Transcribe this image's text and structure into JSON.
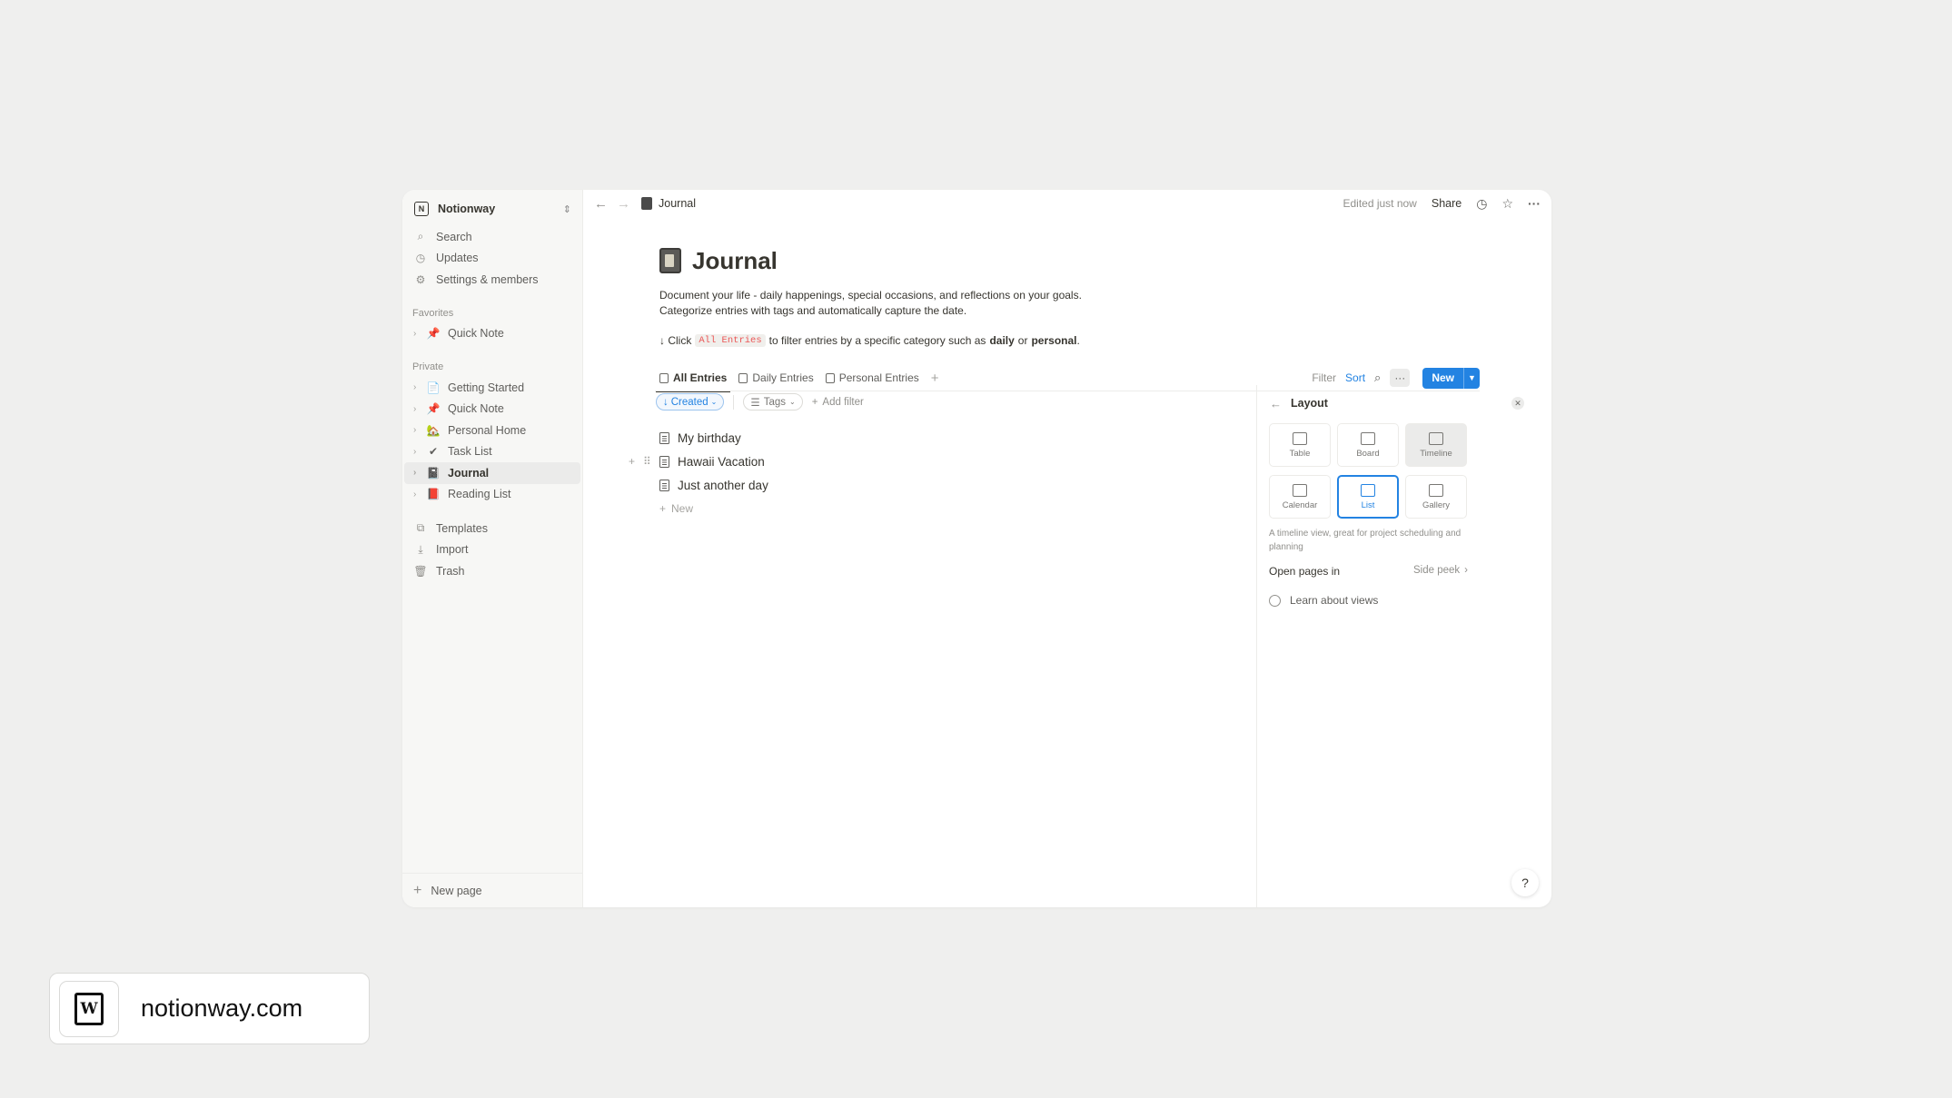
{
  "workspace": {
    "name": "Notionway",
    "icon_letter": "N"
  },
  "sidebar": {
    "nav": [
      {
        "label": "Search",
        "icon": "search-icon"
      },
      {
        "label": "Updates",
        "icon": "clock-icon"
      },
      {
        "label": "Settings & members",
        "icon": "gear-icon"
      }
    ],
    "favorites_label": "Favorites",
    "favorites": [
      {
        "label": "Quick Note",
        "emoji": "📌"
      }
    ],
    "private_label": "Private",
    "private": [
      {
        "label": "Getting Started",
        "emoji": "📄"
      },
      {
        "label": "Quick Note",
        "emoji": "📌"
      },
      {
        "label": "Personal Home",
        "emoji": "🏡"
      },
      {
        "label": "Task List",
        "emoji": "✔"
      },
      {
        "label": "Journal",
        "emoji": "📓"
      },
      {
        "label": "Reading List",
        "emoji": "📕"
      }
    ],
    "tools": [
      {
        "label": "Templates",
        "icon": "templates-icon"
      },
      {
        "label": "Import",
        "icon": "import-icon"
      },
      {
        "label": "Trash",
        "icon": "trash-icon"
      }
    ],
    "new_page": "New page"
  },
  "topbar": {
    "breadcrumb": "Journal",
    "edited": "Edited just now",
    "share": "Share"
  },
  "page": {
    "title": "Journal",
    "desc_line1": "Document your life - daily happenings, special occasions, and reflections on your goals.",
    "desc_line2": "Categorize entries with tags and automatically capture the date.",
    "hint_prefix": "↓ Click",
    "hint_code": "All Entries",
    "hint_mid": "to filter entries by a specific category such as",
    "hint_daily": "daily",
    "hint_or": "or",
    "hint_personal": "personal",
    "hint_end": "."
  },
  "tabs": [
    {
      "label": "All Entries",
      "active": true
    },
    {
      "label": "Daily Entries",
      "active": false
    },
    {
      "label": "Personal Entries",
      "active": false
    }
  ],
  "toolbar": {
    "filter": "Filter",
    "sort": "Sort",
    "new": "New"
  },
  "filters": {
    "created": "Created",
    "tags": "Tags",
    "add_filter": "Add filter"
  },
  "entries": [
    "My birthday",
    "Hawaii Vacation",
    "Just another day"
  ],
  "new_row": "New",
  "layout_panel": {
    "title": "Layout",
    "options": [
      {
        "label": "Table",
        "state": "normal"
      },
      {
        "label": "Board",
        "state": "normal"
      },
      {
        "label": "Timeline",
        "state": "hover"
      },
      {
        "label": "Calendar",
        "state": "normal"
      },
      {
        "label": "List",
        "state": "selected"
      },
      {
        "label": "Gallery",
        "state": "normal"
      }
    ],
    "description": "A timeline view, great for project scheduling and planning",
    "open_pages_label": "Open pages in",
    "open_pages_value": "Side peek",
    "learn": "Learn about views"
  },
  "help": "?",
  "brand": {
    "text": "notionway.com",
    "logo_letter": "W"
  },
  "colors": {
    "accent": "#2383e2",
    "code_red": "#eb5757",
    "background": "#efefee"
  }
}
